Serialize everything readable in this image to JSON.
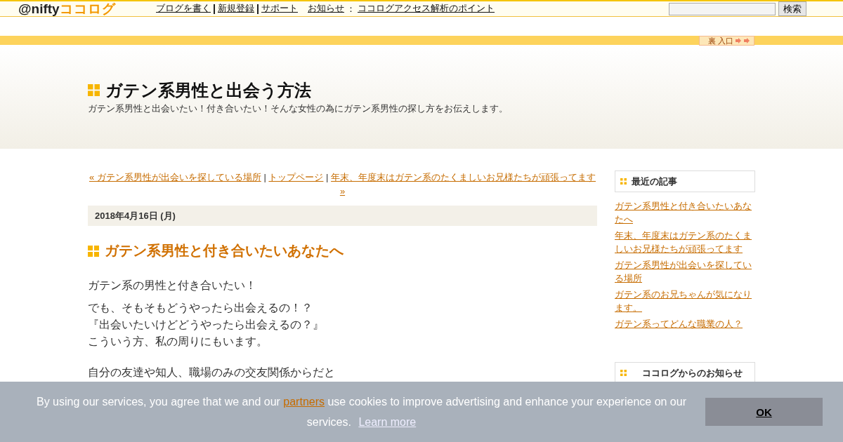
{
  "topbar": {
    "logo": {
      "prefix": "@nifty",
      "name": "ココログ"
    },
    "links": [
      {
        "label": "ブログを書く"
      },
      {
        "label": "新規登録"
      },
      {
        "label": "サポート"
      }
    ],
    "notice": {
      "label": "お知らせ",
      "separator": "：",
      "link": "ココログアクセス解析のポイント"
    },
    "search": {
      "button": "検索"
    }
  },
  "back_entrance": {
    "label": "裏 入口"
  },
  "header": {
    "title": "ガテン系男性と出会う方法",
    "description": "ガテン系男性と出会いたい！付き合いたい！そんな女性の為にガテン系男性の探し方をお伝えします。"
  },
  "nav": {
    "prev": "« ガテン系男性が出会いを探している場所",
    "separator": "|",
    "top": "トップページ",
    "next": "年末、年度末はガテン系のたくましいお兄様たちが頑張ってます",
    "next_arrow": "»"
  },
  "article": {
    "date": "2018年4月16日 (月)",
    "title": "ガテン系男性と付き合いたいあなたへ",
    "paragraphs": [
      [
        "ガテン系の男性と付き合いたい！"
      ],
      [
        "でも、そもそもどうやったら出会えるの！？",
        "『出会いたいけどどうやったら出会えるの？』",
        "こういう方、私の周りにもいます。"
      ],
      [
        "自分の友達や知人、職場のみの交友関係からだと"
      ]
    ]
  },
  "sidebar": {
    "sections": [
      {
        "title": "最近の記事",
        "links": [
          "ガテン系男性と付き合いたいあなたへ",
          "年末、年度末はガテン系のたくましいお兄様たちが頑張ってます",
          "ガテン系男性が出会いを探している場所",
          "ガテン系のお兄ちゃんが気になります。",
          "ガテン系ってどんな職業の人？"
        ]
      },
      {
        "title": "ココログからのお知らせ"
      }
    ]
  },
  "cookie_banner": {
    "before": "By using our services, you agree that we and our ",
    "link": "partners",
    "after": " use cookies to improve advertising and enhance your experience on our services.",
    "learn_more": "Learn more",
    "button": "OK"
  }
}
